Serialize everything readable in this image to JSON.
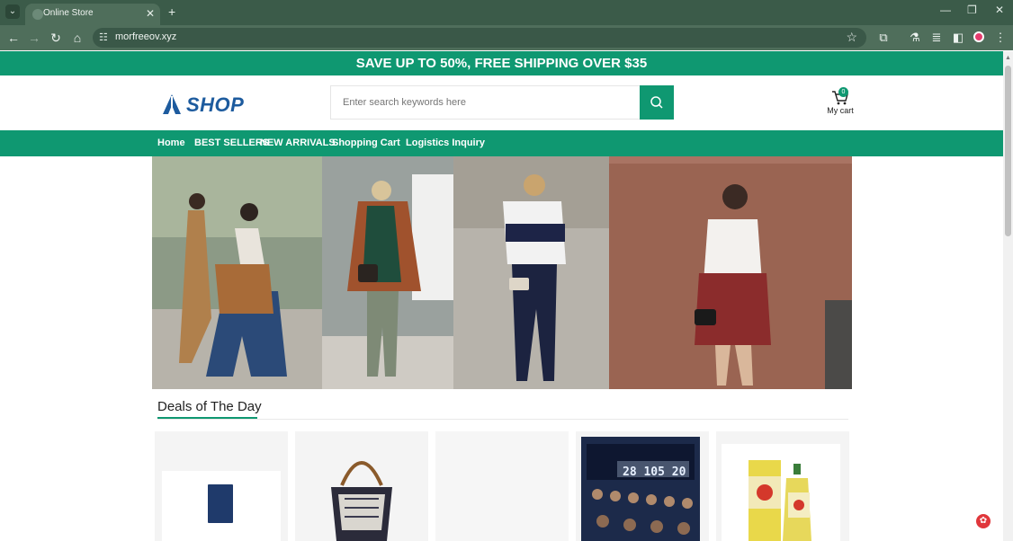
{
  "browser": {
    "tab_title": "Online Store",
    "url": "morfreeov.xyz",
    "new_tab_label": "+",
    "close_tab_label": "✕"
  },
  "promo": {
    "text": "SAVE UP TO 50%, FREE SHIPPING OVER $35"
  },
  "header": {
    "logo_text": "SHOP",
    "search_placeholder": "Enter search keywords here",
    "cart_count": "0",
    "cart_label": "My cart"
  },
  "nav": {
    "items": [
      {
        "label": "Home"
      },
      {
        "label": "BEST SELLERS"
      },
      {
        "label": "NEW ARRIVALS"
      },
      {
        "label": "Shopping Cart"
      },
      {
        "label": "Logistics Inquiry"
      }
    ]
  },
  "deals": {
    "title": "Deals of The Day"
  },
  "products": {
    "cards": [
      {
        "icon": "passport-wallet-image"
      },
      {
        "icon": "bucket-bag-image"
      },
      {
        "icon": "blank-image"
      },
      {
        "icon": "cb-radio-image",
        "display_text": "28 105 20"
      },
      {
        "icon": "perfume-bottles-image"
      }
    ]
  },
  "colors": {
    "brand": "#0f9871",
    "logo_blue": "#1d5b9e",
    "browser_frame": "#4f6e5b"
  }
}
